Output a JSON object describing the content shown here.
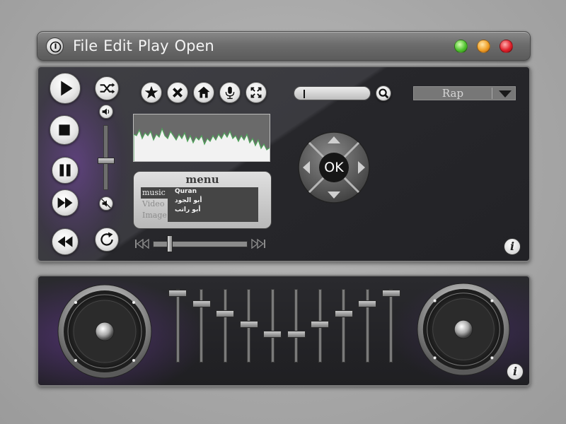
{
  "menu": {
    "items": [
      "File",
      "Edit",
      "Play",
      "Open"
    ]
  },
  "window_lights": [
    {
      "name": "green-light",
      "color": "#4fc22f"
    },
    {
      "name": "orange-light",
      "color": "#f0a028"
    },
    {
      "name": "red-light",
      "color": "#e0202a"
    }
  ],
  "search": {
    "value": ""
  },
  "genre_select": {
    "value": "Rap"
  },
  "playlist": {
    "title": "menu",
    "categories": [
      "music",
      "Video",
      "Image"
    ],
    "active_category": "music",
    "entries": [
      "Quran",
      "أبو الجود",
      "أبو راتب"
    ]
  },
  "seek": {
    "position": 0.18
  },
  "volume": {
    "level": 0.46
  },
  "dpad": {
    "center_label": "OK"
  },
  "info": {
    "label": "i"
  },
  "equalizer": {
    "bands": [
      0.94,
      0.8,
      0.66,
      0.52,
      0.38,
      0.38,
      0.52,
      0.66,
      0.8,
      0.94
    ]
  },
  "colors": {
    "accent_purple": "#6e46aa",
    "panel": "#2b2b30",
    "button": "#e8e8e8"
  },
  "icons": [
    "power-icon",
    "play-icon",
    "stop-icon",
    "pause-icon",
    "fast-forward-icon",
    "rewind-icon",
    "shuffle-icon",
    "volume-icon",
    "mute-icon",
    "repeat-icon",
    "star-icon",
    "close-icon",
    "home-icon",
    "microphone-icon",
    "fullscreen-icon",
    "search-icon",
    "skip-back-icon",
    "skip-forward-icon",
    "dropdown-arrow-icon",
    "info-icon",
    "speaker-left",
    "speaker-right"
  ]
}
